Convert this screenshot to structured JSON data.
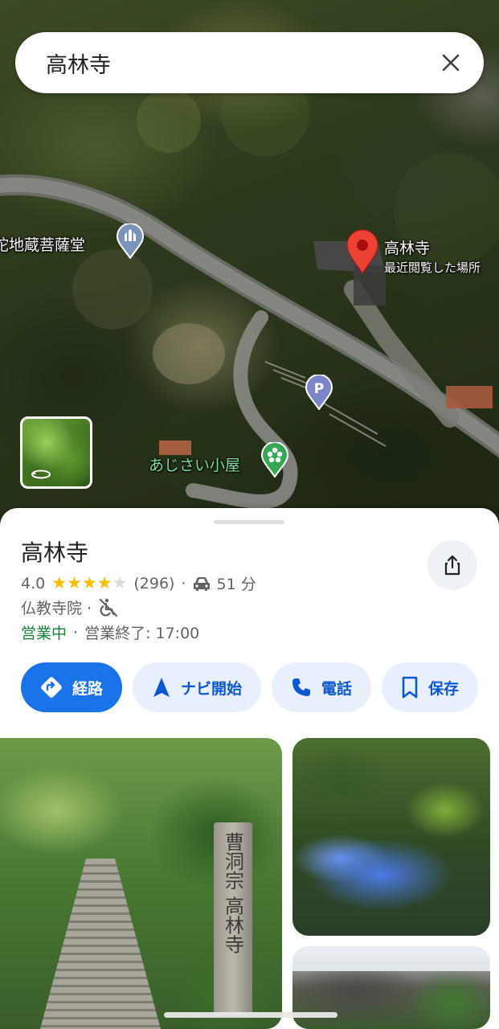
{
  "search": {
    "query": "高林寺"
  },
  "map": {
    "labels": {
      "jizo": "阿弥陀地蔵菩薩堂",
      "temple": "高林寺",
      "temple_sub": "最近閲覧した場所",
      "ajisai": "あじさい小屋"
    },
    "pin_color": "#ea4335"
  },
  "place": {
    "title": "高林寺",
    "rating": "4.0",
    "stars": 4,
    "review_count": "(296)",
    "drive_time": "51 分",
    "category": "仏教寺院 ·",
    "open_status": "営業中",
    "hours": "営業終了: 17:00"
  },
  "actions": {
    "directions": "経路",
    "navigate": "ナビ開始",
    "call": "電話",
    "save": "保存"
  },
  "photos": {
    "stone_inscription": "曹洞宗 高林寺"
  },
  "colors": {
    "accent": "#1a73e8",
    "open_green": "#188038",
    "star": "#fbbc04"
  }
}
